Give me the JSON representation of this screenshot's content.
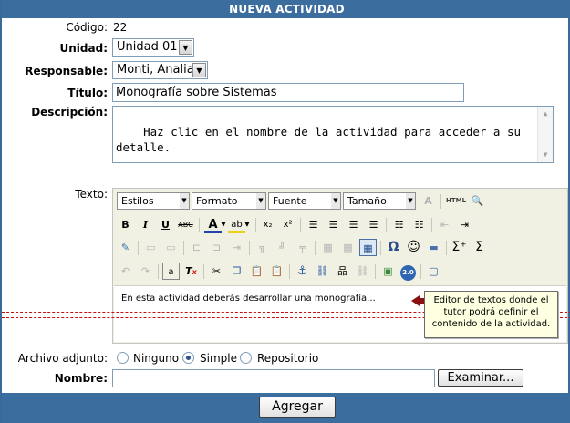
{
  "header": {
    "title": "NUEVA ACTIVIDAD"
  },
  "form": {
    "codigo": {
      "label": "Código:",
      "value": "22"
    },
    "unidad": {
      "label": "Unidad:",
      "value": "Unidad 01"
    },
    "responsable": {
      "label": "Responsable:",
      "value": "Monti, Analia"
    },
    "titulo": {
      "label": "Título:",
      "value": "Monografía sobre Sistemas"
    },
    "descripcion": {
      "label": "Descripción:",
      "value": "Haz clic en el nombre de la actividad para acceder a su detalle."
    },
    "texto": {
      "label": "Texto:"
    }
  },
  "editor": {
    "styles": "Estilos",
    "format": "Formato",
    "font": "Fuente",
    "size": "Tamaño",
    "content": "En esta actividad deberás desarrollar una monografía..."
  },
  "tooltip": {
    "text": "Editor de textos donde el tutor podrá definir el contenido de la actividad."
  },
  "attachment": {
    "label": "Archivo adjunto:",
    "options": [
      "Ninguno",
      "Simple",
      "Repositorio"
    ],
    "selected": "Simple"
  },
  "nombre": {
    "label": "Nombre:",
    "value": "",
    "browse_label": "Examinar..."
  },
  "submit_label": "Agregar"
}
